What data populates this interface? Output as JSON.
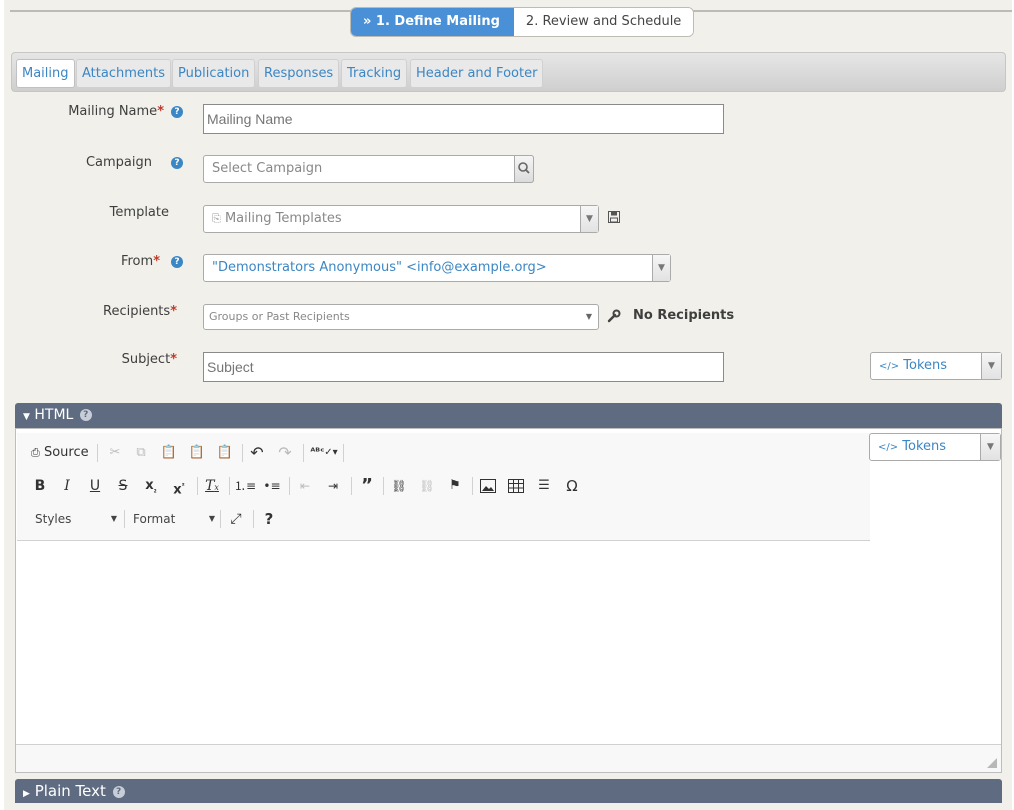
{
  "wizard": {
    "steps": [
      {
        "label": "» 1. Define Mailing"
      },
      {
        "label": "2. Review and Schedule"
      }
    ]
  },
  "tabs": [
    "Mailing",
    "Attachments",
    "Publication",
    "Responses",
    "Tracking",
    "Header and Footer"
  ],
  "form": {
    "mailing_name": {
      "label": "Mailing Name",
      "placeholder": "Mailing Name"
    },
    "campaign": {
      "label": "Campaign",
      "placeholder": "Select Campaign"
    },
    "template": {
      "label": "Template",
      "placeholder": "Mailing Templates"
    },
    "from": {
      "label": "From",
      "value": "\"Demonstrators Anonymous\" <info@example.org>"
    },
    "recipients": {
      "label": "Recipients",
      "placeholder": "Groups or Past Recipients",
      "status": "No Recipients"
    },
    "subject": {
      "label": "Subject",
      "placeholder": "Subject",
      "tokens": "Tokens"
    },
    "required_mark": "*",
    "help_glyph": "?"
  },
  "html_section": {
    "title": "HTML",
    "tokens": "Tokens",
    "toolbar": {
      "source": "Source",
      "styles": "Styles",
      "format": "Format"
    }
  },
  "plain_text_section": {
    "title": "Plain Text"
  },
  "colors": {
    "accent": "#4a90d6",
    "link": "#3b86c4",
    "section_bar": "#5e6b80",
    "required": "#c0392b"
  }
}
